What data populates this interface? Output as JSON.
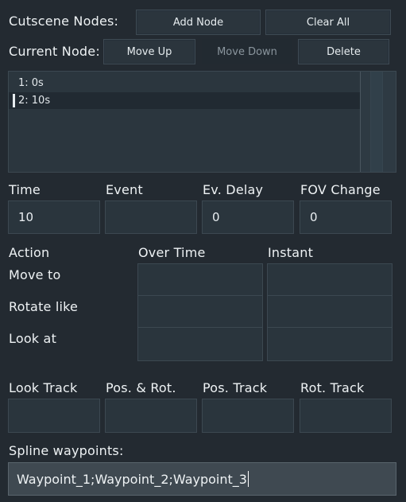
{
  "header": {
    "cutscene_nodes_label": "Cutscene Nodes:",
    "current_node_label": "Current Node:",
    "buttons": {
      "add_node": "Add Node",
      "clear_all": "Clear All",
      "move_up": "Move Up",
      "move_down": "Move Down",
      "delete": "Delete"
    }
  },
  "node_list": {
    "items": [
      {
        "label": "1: 0s",
        "selected": false
      },
      {
        "label": "2: 10s",
        "selected": true
      }
    ]
  },
  "properties": {
    "time": {
      "label": "Time",
      "value": "10"
    },
    "event": {
      "label": "Event",
      "value": ""
    },
    "ev_delay": {
      "label": "Ev. Delay",
      "value": "0"
    },
    "fov_change": {
      "label": "FOV Change",
      "value": "0"
    }
  },
  "actions": {
    "header_action": "Action",
    "header_over_time": "Over Time",
    "header_instant": "Instant",
    "rows": [
      {
        "label": "Move to"
      },
      {
        "label": "Rotate like"
      },
      {
        "label": "Look at"
      }
    ]
  },
  "tracks": {
    "look_track": "Look Track",
    "pos_rot": "Pos. & Rot.",
    "pos_track": "Pos. Track",
    "rot_track": "Rot. Track"
  },
  "spline": {
    "label": "Spline waypoints:",
    "value": "Waypoint_1;Waypoint_2;Waypoint_3"
  }
}
